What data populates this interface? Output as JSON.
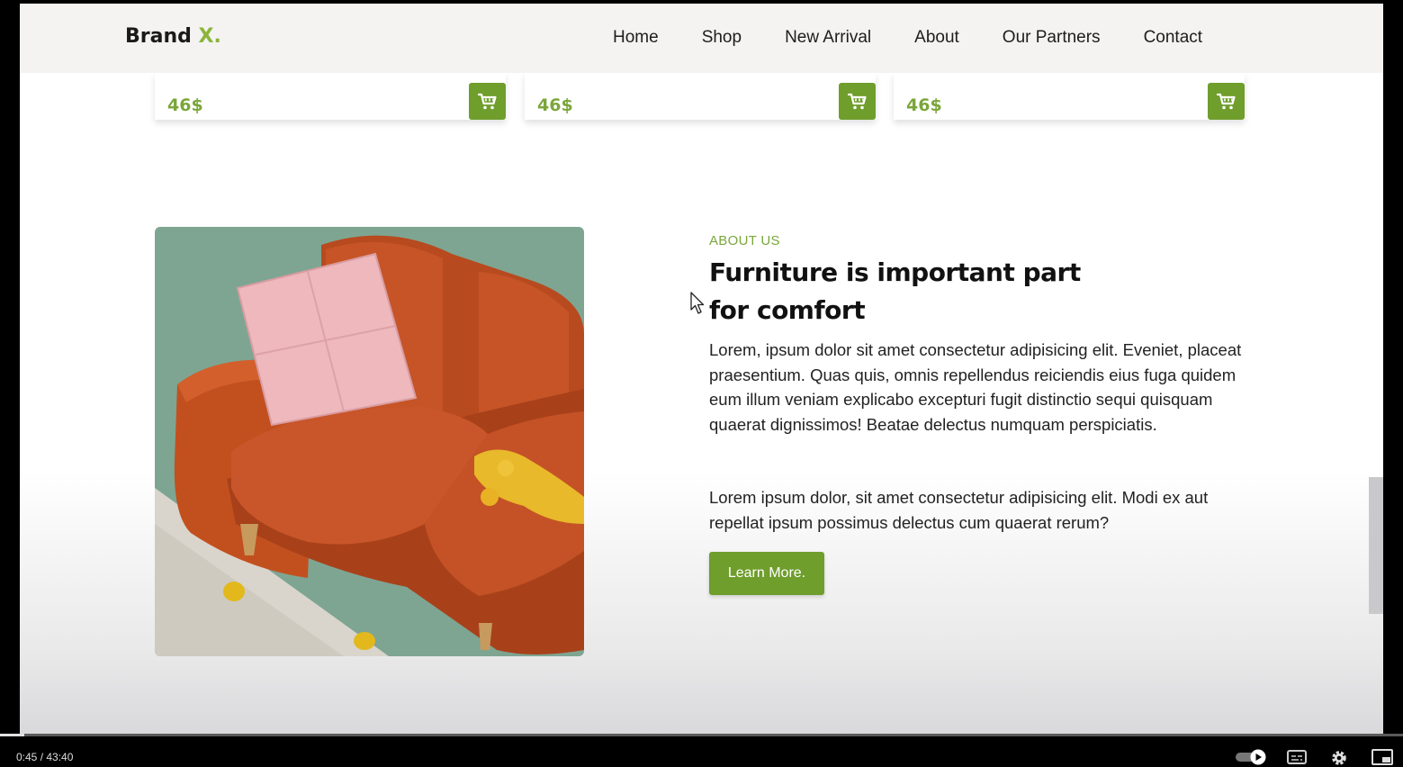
{
  "navbar": {
    "brand": "Brand",
    "brand_accent": "X.",
    "links": [
      "Home",
      "Shop",
      "New Arrival",
      "About",
      "Our Partners",
      "Contact"
    ]
  },
  "products": [
    {
      "price": "46$"
    },
    {
      "price": "46$"
    },
    {
      "price": "46$"
    }
  ],
  "about": {
    "label": "ABOUT US",
    "title": "Furniture is important part for comfort",
    "paragraph1": "Lorem, ipsum dolor sit amet consectetur adipisicing elit. Eveniet, placeat praesentium. Quas quis, omnis repellendus reiciendis eius fuga quidem eum illum veniam explicabo excepturi fugit distinctio sequi quisquam quaerat dignissimos! Beatae delectus numquam perspiciatis.",
    "paragraph2": "Lorem ipsum dolor, sit amet consectetur adipisicing elit. Modi ex aut repellat ipsum possimus delectus cum quaerat rerum?",
    "button": "Learn More."
  },
  "player": {
    "timecode": "0:45 / 43:40",
    "progress_fraction": 0.017
  },
  "colors": {
    "accent": "#8ab53a",
    "button": "#6f9e2c",
    "price": "#7aa63a",
    "sofa": "#c24e22",
    "wall": "#7ea592"
  },
  "icons": [
    "cart-icon",
    "cursor-icon",
    "autoplay-toggle-icon",
    "captions-icon",
    "settings-icon",
    "miniplayer-icon"
  ]
}
